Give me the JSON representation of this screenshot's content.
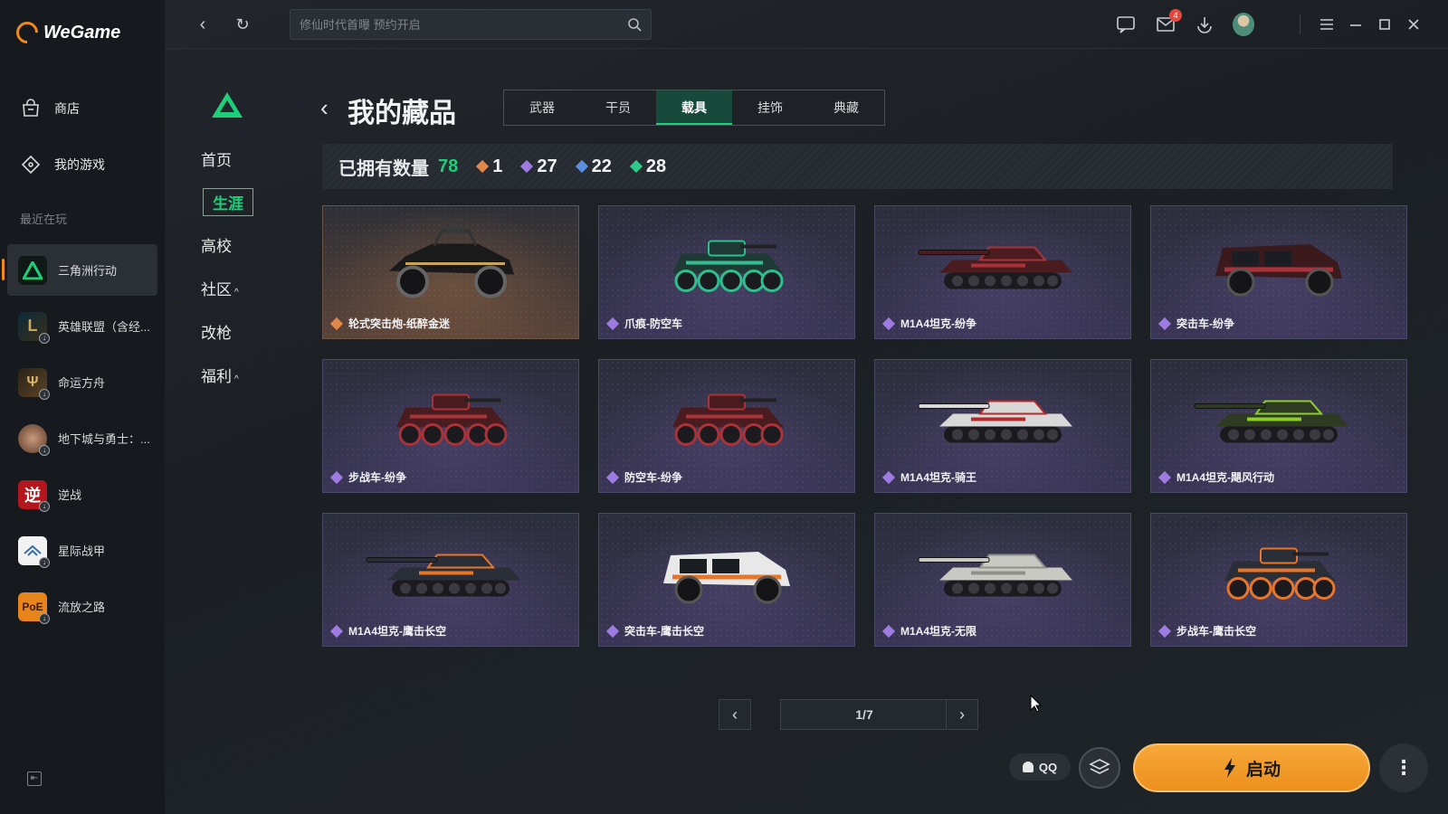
{
  "app": {
    "name": "WeGame"
  },
  "sidebar": {
    "nav": [
      {
        "label": "商店",
        "icon": "store-bag-icon"
      },
      {
        "label": "我的游戏",
        "icon": "gamepad-icon"
      }
    ],
    "recent_label": "最近在玩",
    "games": [
      {
        "label": "三角洲行动",
        "active": true
      },
      {
        "label": "英雄联盟（含经..."
      },
      {
        "label": "命运方舟"
      },
      {
        "label": "地下城与勇士：..."
      },
      {
        "label": "逆战",
        "icon_text": "逆"
      },
      {
        "label": "星际战甲"
      },
      {
        "label": "流放之路",
        "icon_text": "PoE"
      }
    ]
  },
  "topbar": {
    "search_placeholder": "修仙时代首曝 预约开启",
    "mail_badge": "4"
  },
  "game_nav": {
    "items": [
      {
        "label": "首页"
      },
      {
        "label": "生涯",
        "active": true
      },
      {
        "label": "高校"
      },
      {
        "label": "社区",
        "chevron": "^"
      },
      {
        "label": "改枪"
      },
      {
        "label": "福利",
        "chevron": "^"
      }
    ]
  },
  "page": {
    "title": "我的藏品",
    "tabs": [
      {
        "label": "武器"
      },
      {
        "label": "干员"
      },
      {
        "label": "载具",
        "active": true
      },
      {
        "label": "挂饰"
      },
      {
        "label": "典藏"
      }
    ],
    "owned_label": "已拥有数量",
    "owned_total": "78",
    "rarity_counts": [
      {
        "value": "1",
        "color": "#e0884a"
      },
      {
        "value": "27",
        "color": "#9d7be0"
      },
      {
        "value": "22",
        "color": "#5a8fe0"
      },
      {
        "value": "28",
        "color": "#2ec98a"
      }
    ]
  },
  "items": [
    {
      "name": "轮式突击炮-纸醉金迷",
      "rarity_color": "#e0884a",
      "vehicle": "buggy",
      "paint": "#1a1a1a",
      "accent": "#c9a45a"
    },
    {
      "name": "爪痕-防空车",
      "rarity_color": "#9d7be0",
      "vehicle": "apc",
      "paint": "#1f3a34",
      "accent": "#2fbf8f"
    },
    {
      "name": "M1A4坦克-纷争",
      "rarity_color": "#9d7be0",
      "vehicle": "tank",
      "paint": "#4a1c1f",
      "accent": "#a8333a"
    },
    {
      "name": "突击车-纷争",
      "rarity_color": "#9d7be0",
      "vehicle": "truck",
      "paint": "#3a1a1d",
      "accent": "#a8333a"
    },
    {
      "name": "步战车-纷争",
      "rarity_color": "#9d7be0",
      "vehicle": "apc",
      "paint": "#4a1c1f",
      "accent": "#a8333a"
    },
    {
      "name": "防空车-纷争",
      "rarity_color": "#9d7be0",
      "vehicle": "apc",
      "paint": "#4a1c1f",
      "accent": "#a8333a"
    },
    {
      "name": "M1A4坦克-骑王",
      "rarity_color": "#9d7be0",
      "vehicle": "tank",
      "paint": "#d8d8d8",
      "accent": "#b32a2a"
    },
    {
      "name": "M1A4坦克-飓风行动",
      "rarity_color": "#9d7be0",
      "vehicle": "tank",
      "paint": "#2e3a22",
      "accent": "#8ccf2a"
    },
    {
      "name": "M1A4坦克-鹰击长空",
      "rarity_color": "#9d7be0",
      "vehicle": "tank",
      "paint": "#2a2e36",
      "accent": "#e8762a"
    },
    {
      "name": "突击车-鹰击长空",
      "rarity_color": "#9d7be0",
      "vehicle": "truck",
      "paint": "#e8e8e8",
      "accent": "#e8762a"
    },
    {
      "name": "M1A4坦克-无限",
      "rarity_color": "#9d7be0",
      "vehicle": "tank",
      "paint": "#c9c9c4",
      "accent": "#8f8f8a"
    },
    {
      "name": "步战车-鹰击长空",
      "rarity_color": "#9d7be0",
      "vehicle": "apc",
      "paint": "#2a2e36",
      "accent": "#e8762a"
    }
  ],
  "pagination": {
    "label": "1/7"
  },
  "actions": {
    "qq_label": "QQ",
    "launch_label": "启动"
  }
}
